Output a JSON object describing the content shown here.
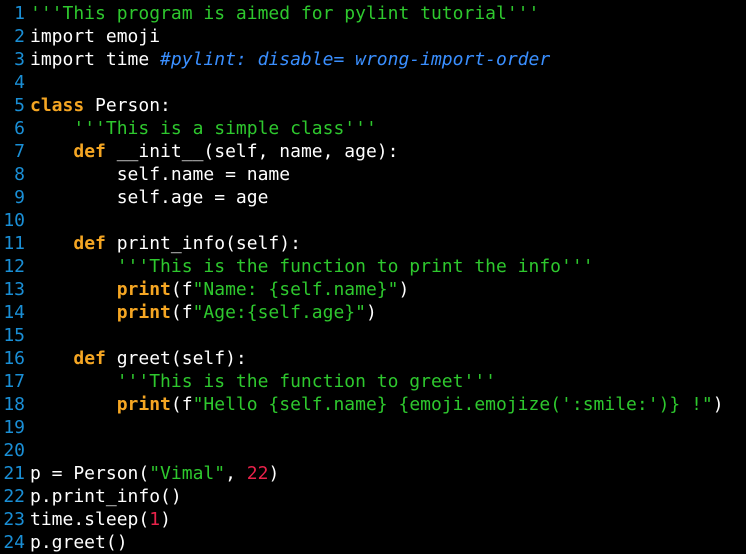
{
  "colors": {
    "background": "#000000",
    "line_number": "#1a8fd6",
    "default": "#ffffff",
    "keyword": "#f5a623",
    "string": "#2ec82e",
    "comment": "#3a8fff",
    "number": "#e8224a"
  },
  "editor": {
    "lines": [
      {
        "n": "1",
        "tokens": [
          {
            "t": "string",
            "v": "'''This program is aimed for pylint tutorial'''"
          }
        ]
      },
      {
        "n": "2",
        "tokens": [
          {
            "t": "default",
            "v": "import emoji"
          }
        ]
      },
      {
        "n": "3",
        "tokens": [
          {
            "t": "default",
            "v": "import time "
          },
          {
            "t": "comment",
            "v": "#pylint: disable= wrong-import-order"
          }
        ]
      },
      {
        "n": "4",
        "tokens": []
      },
      {
        "n": "5",
        "tokens": [
          {
            "t": "keyword",
            "v": "class"
          },
          {
            "t": "default",
            "v": " Person:"
          }
        ]
      },
      {
        "n": "6",
        "tokens": [
          {
            "t": "default",
            "v": "    "
          },
          {
            "t": "string",
            "v": "'''This is a simple class'''"
          }
        ]
      },
      {
        "n": "7",
        "tokens": [
          {
            "t": "default",
            "v": "    "
          },
          {
            "t": "keyword",
            "v": "def"
          },
          {
            "t": "default",
            "v": " __init__(self, name, age):"
          }
        ]
      },
      {
        "n": "8",
        "tokens": [
          {
            "t": "default",
            "v": "        self.name = name"
          }
        ]
      },
      {
        "n": "9",
        "tokens": [
          {
            "t": "default",
            "v": "        self.age = age"
          }
        ]
      },
      {
        "n": "10",
        "tokens": []
      },
      {
        "n": "11",
        "tokens": [
          {
            "t": "default",
            "v": "    "
          },
          {
            "t": "keyword",
            "v": "def"
          },
          {
            "t": "default",
            "v": " print_info(self):"
          }
        ]
      },
      {
        "n": "12",
        "tokens": [
          {
            "t": "default",
            "v": "        "
          },
          {
            "t": "string",
            "v": "'''This is the function to print the info'''"
          }
        ]
      },
      {
        "n": "13",
        "tokens": [
          {
            "t": "default",
            "v": "        "
          },
          {
            "t": "keyword",
            "v": "print"
          },
          {
            "t": "default",
            "v": "(f"
          },
          {
            "t": "string",
            "v": "\"Name: {self.name}\""
          },
          {
            "t": "default",
            "v": ")"
          }
        ]
      },
      {
        "n": "14",
        "tokens": [
          {
            "t": "default",
            "v": "        "
          },
          {
            "t": "keyword",
            "v": "print"
          },
          {
            "t": "default",
            "v": "(f"
          },
          {
            "t": "string",
            "v": "\"Age:{self.age}\""
          },
          {
            "t": "default",
            "v": ")"
          }
        ]
      },
      {
        "n": "15",
        "tokens": []
      },
      {
        "n": "16",
        "tokens": [
          {
            "t": "default",
            "v": "    "
          },
          {
            "t": "keyword",
            "v": "def"
          },
          {
            "t": "default",
            "v": " greet(self):"
          }
        ]
      },
      {
        "n": "17",
        "tokens": [
          {
            "t": "default",
            "v": "        "
          },
          {
            "t": "string",
            "v": "'''This is the function to greet'''"
          }
        ]
      },
      {
        "n": "18",
        "tokens": [
          {
            "t": "default",
            "v": "        "
          },
          {
            "t": "keyword",
            "v": "print"
          },
          {
            "t": "default",
            "v": "(f"
          },
          {
            "t": "string",
            "v": "\"Hello {self.name} {emoji.emojize(':smile:')} !\""
          },
          {
            "t": "default",
            "v": ")"
          }
        ]
      },
      {
        "n": "19",
        "tokens": []
      },
      {
        "n": "20",
        "tokens": []
      },
      {
        "n": "21",
        "tokens": [
          {
            "t": "default",
            "v": "p = Person("
          },
          {
            "t": "string",
            "v": "\"Vimal\""
          },
          {
            "t": "default",
            "v": ", "
          },
          {
            "t": "number",
            "v": "22"
          },
          {
            "t": "default",
            "v": ")"
          }
        ]
      },
      {
        "n": "22",
        "tokens": [
          {
            "t": "default",
            "v": "p.print_info()"
          }
        ]
      },
      {
        "n": "23",
        "tokens": [
          {
            "t": "default",
            "v": "time.sleep("
          },
          {
            "t": "number",
            "v": "1"
          },
          {
            "t": "default",
            "v": ")"
          }
        ]
      },
      {
        "n": "24",
        "tokens": [
          {
            "t": "default",
            "v": "p.greet()"
          }
        ]
      }
    ]
  }
}
